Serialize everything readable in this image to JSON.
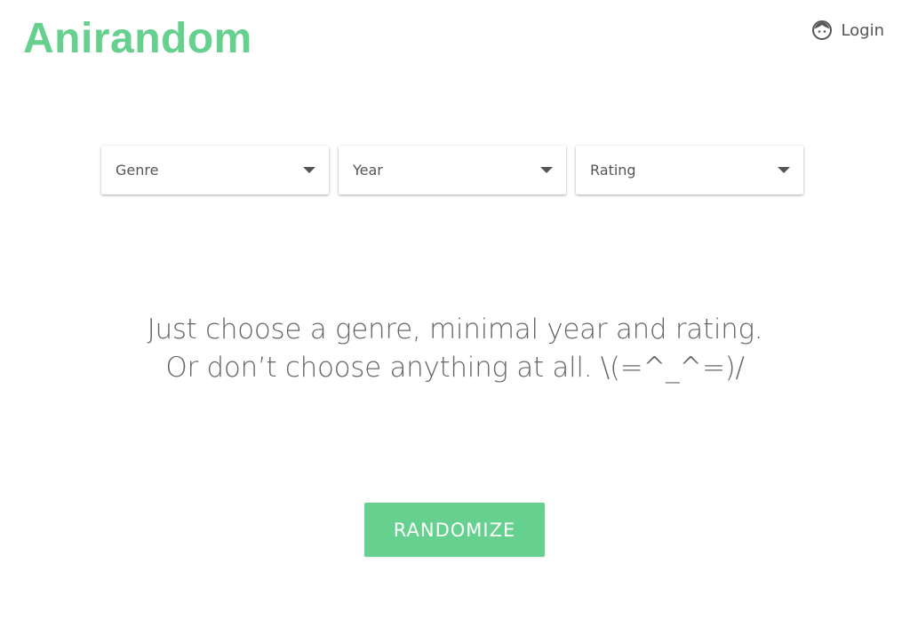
{
  "header": {
    "logo_text": "Anirandom",
    "login_label": "Login",
    "login_icon": "user-face-icon"
  },
  "filters": {
    "genre_label": "Genre",
    "year_label": "Year",
    "rating_label": "Rating",
    "caret_icon": "caret-down-icon"
  },
  "tagline": {
    "line1": "Just choose a genre, minimal year and rating.",
    "line2": "Or don’t choose anything at all. \\(=^_^=)/"
  },
  "actions": {
    "randomize_label": "RANDOMIZE"
  },
  "colors": {
    "brand": "#66d08e",
    "text": "#555555",
    "tagline_text": "#666666",
    "background": "#ffffff"
  }
}
